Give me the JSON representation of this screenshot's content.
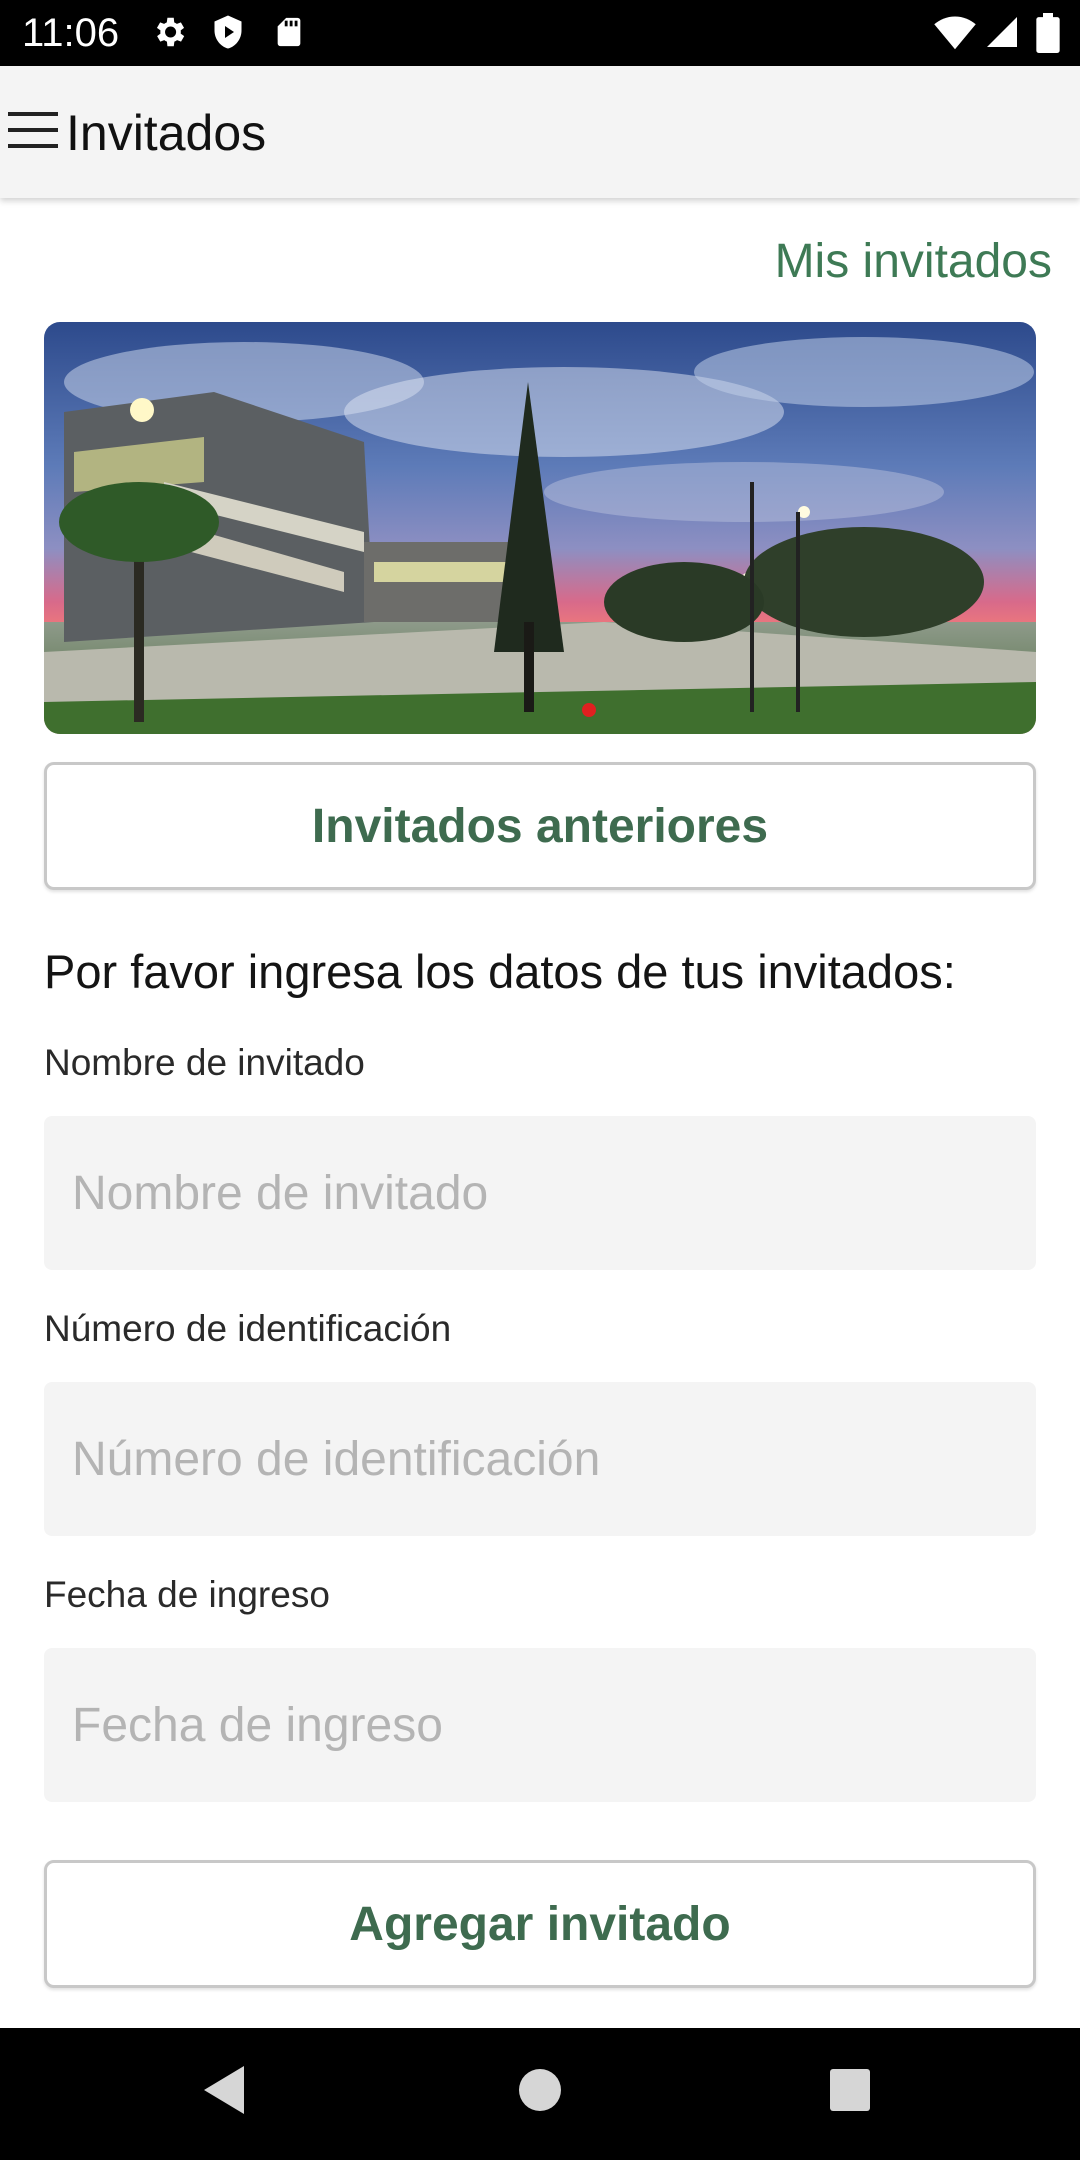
{
  "status_bar": {
    "time": "11:06",
    "left_icons": [
      "gear-icon",
      "shield-icon",
      "sd-card-icon"
    ],
    "right_icons": [
      "wifi-icon",
      "signal-icon",
      "battery-icon"
    ]
  },
  "app_bar": {
    "title": "Invitados",
    "menu_icon": "hamburger-menu-icon"
  },
  "content": {
    "mis_invitados_link": "Mis invitados",
    "banner_image": "campus-at-dusk-photo",
    "previous_guests_button": "Invitados anteriores",
    "instructions": "Por favor ingresa los datos de tus invitados:",
    "fields": [
      {
        "label": "Nombre de invitado",
        "placeholder": "Nombre de invitado",
        "value": ""
      },
      {
        "label": "Número de identificación",
        "placeholder": "Número de identificación",
        "value": ""
      },
      {
        "label": "Fecha de ingreso",
        "placeholder": "Fecha de ingreso",
        "value": ""
      }
    ],
    "add_guest_button": "Agregar invitado"
  },
  "nav_bar": {
    "buttons": [
      "back-icon",
      "home-icon",
      "recents-icon"
    ]
  },
  "colors": {
    "accent_green": "#3e7a55",
    "button_text_green": "#3e6b4f",
    "input_background": "#f4f4f4",
    "app_bar_background": "#f4f4f4"
  }
}
